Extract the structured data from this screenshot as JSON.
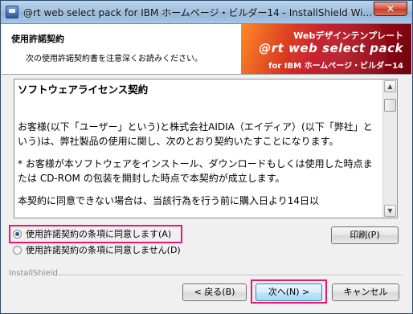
{
  "window": {
    "title": "@rt web select pack for IBM ホームページ・ビルダー14 - InstallShield Wi...",
    "close_label": "✕"
  },
  "header": {
    "title": "使用許諾契約",
    "subtitle": "次の使用許諾契約書を注意深くお読みください。",
    "banner_line1": "Webデザインテンプレート",
    "banner_line2": "@rt web select pack",
    "banner_line3": "for IBM ホームページ・ビルダー14"
  },
  "license": {
    "heading": "ソフトウェアライセンス契約",
    "paragraph1": "お客様(以下「ユーザー」という)と株式会社AIDIA（エイディア）(以下「弊社」という)は、弊社製品の使用に関し、次のとおり契約いたすことになります。",
    "paragraph2": "* お客様が本ソフトウェアをインストール、ダウンロードもしくは使用した時点または CD-ROM の包装を開封した時点で本契約が成立します。",
    "paragraph3": "本契約に同意できない場合は、当該行為を行う前に購入日より14日以"
  },
  "options": {
    "accept_label": "使用許諾契約の条項に同意します(A)",
    "decline_label": "使用許諾契約の条項に同意しません(D)",
    "selected": "accept"
  },
  "buttons": {
    "print": "印刷(P)",
    "back": "< 戻る(B)",
    "next": "次へ(N) >",
    "cancel": "キャンセル"
  },
  "footer": {
    "brand": "InstallShield"
  }
}
